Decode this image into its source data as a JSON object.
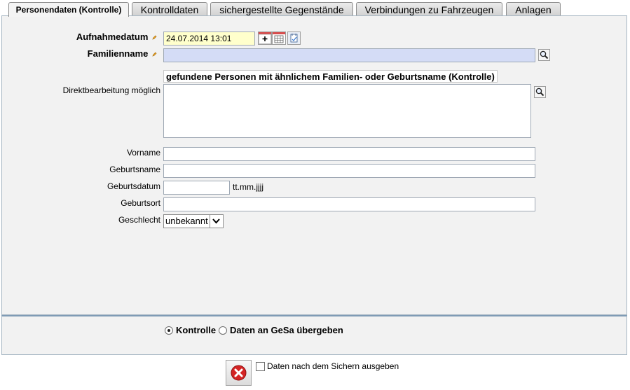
{
  "tabs": [
    {
      "label": "Personendaten (Kontrolle)",
      "active": true
    },
    {
      "label": "Kontrolldaten",
      "active": false
    },
    {
      "label": "sichergestellte Gegenstände",
      "active": false
    },
    {
      "label": "Verbindungen zu Fahrzeugen",
      "active": false
    },
    {
      "label": "Anlagen",
      "active": false
    }
  ],
  "form": {
    "aufnahmedatum_label": "Aufnahmedatum",
    "aufnahmedatum_value": "24.07.2014 13:01",
    "familienname_label": "Familienname",
    "familienname_value": "",
    "found_heading": "gefundene Personen mit ähnlichem Familien- oder Geburtsname (Kontrolle)",
    "direkt_label": "Direktbearbeitung möglich",
    "vorname_label": "Vorname",
    "vorname_value": "",
    "geburtsname_label": "Geburtsname",
    "geburtsname_value": "",
    "geburtsdatum_label": "Geburtsdatum",
    "geburtsdatum_value": "",
    "geburtsdatum_hint": "tt.mm.jjjj",
    "geburtsort_label": "Geburtsort",
    "geburtsort_value": "",
    "geschlecht_label": "Geschlecht",
    "geschlecht_value": "unbekannt"
  },
  "mode": {
    "option1": "Kontrolle",
    "option2": "Daten an GeSa übergeben",
    "selected": "Kontrolle"
  },
  "footer": {
    "print_checkbox_label": "Daten nach dem Sichern ausgeben",
    "print_checked": false
  },
  "colors": {
    "required_marker": "#e8a020",
    "cancel_red": "#d42424",
    "panel_border": "#a7b7c4"
  },
  "icons": {
    "pencil": "pencil-icon",
    "search": "search-icon",
    "calendar": "calendar-icon",
    "cancel": "cancel-icon"
  }
}
